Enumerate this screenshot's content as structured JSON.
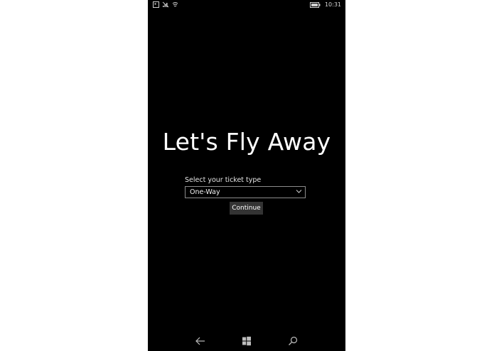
{
  "status_bar": {
    "time": "10:31",
    "icons": [
      "notification-icon",
      "no-signal-icon",
      "wifi-icon",
      "battery-icon"
    ]
  },
  "main": {
    "title": "Let's Fly Away",
    "ticket_label": "Select your ticket type",
    "ticket_select": {
      "selected": "One-Way"
    },
    "continue_label": "Continue"
  },
  "nav_bar": {
    "icons": [
      "back-arrow-icon",
      "windows-start-icon",
      "search-icon"
    ]
  },
  "colors": {
    "background": "#000000",
    "text": "#ffffff",
    "button_bg": "#333333",
    "border": "#8c8c8c"
  }
}
